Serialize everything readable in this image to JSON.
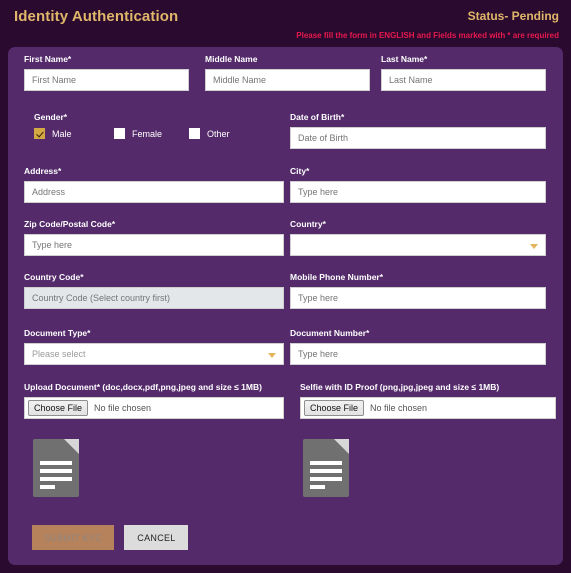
{
  "header": {
    "title": "Identity Authentication",
    "status": "Status- Pending",
    "notice": "Please fill the form in ENGLISH and Fields marked with * are required",
    "title_color": "#e0b76a",
    "notice_color": "#e8194e"
  },
  "theme": {
    "page_background": "#2a0a2e",
    "card_background": "#542a6b",
    "accent": "#e0b76a",
    "submit_button": "#b5825c",
    "cancel_button": "#dcdcdc"
  },
  "form": {
    "first_name": {
      "label": "First Name*",
      "placeholder": "First Name",
      "value": ""
    },
    "middle_name": {
      "label": "Middle Name",
      "placeholder": "Middle Name",
      "value": ""
    },
    "last_name": {
      "label": "Last Name*",
      "placeholder": "Last Name",
      "value": ""
    },
    "gender": {
      "label": "Gender*",
      "options": [
        {
          "label": "Male",
          "checked": true
        },
        {
          "label": "Female",
          "checked": false
        },
        {
          "label": "Other",
          "checked": false
        }
      ]
    },
    "date_of_birth": {
      "label": "Date of Birth*",
      "placeholder": "Date of Birth",
      "value": ""
    },
    "address": {
      "label": "Address*",
      "placeholder": "Address",
      "value": ""
    },
    "city": {
      "label": "City*",
      "placeholder": "Type here",
      "value": ""
    },
    "zip_code": {
      "label": "Zip Code/Postal Code*",
      "placeholder": "Type here",
      "value": ""
    },
    "country": {
      "label": "Country*",
      "selected": "",
      "icon": "chevron-down-icon"
    },
    "country_code": {
      "label": "Country Code*",
      "placeholder": "Country Code (Select country first)",
      "value": "",
      "disabled": true
    },
    "mobile_phone": {
      "label": "Mobile Phone Number*",
      "placeholder": "Type here",
      "value": ""
    },
    "document_type": {
      "label": "Document Type*",
      "selected": "Please select",
      "icon": "chevron-down-icon"
    },
    "document_number": {
      "label": "Document Number*",
      "placeholder": "Type here",
      "value": ""
    },
    "upload_document": {
      "label": "Upload Document* (doc,docx,pdf,png,jpeg and size ≤ 1MB)",
      "button": "Choose File",
      "status": "No file chosen",
      "preview_icon": "document-file-icon"
    },
    "selfie_document": {
      "label": "Selfie with ID Proof (png,jpg,jpeg and size ≤ 1MB)",
      "button": "Choose File",
      "status": "No file chosen",
      "preview_icon": "document-file-icon"
    }
  },
  "actions": {
    "submit": "SUBMIT KYC",
    "cancel": "CANCEL"
  }
}
